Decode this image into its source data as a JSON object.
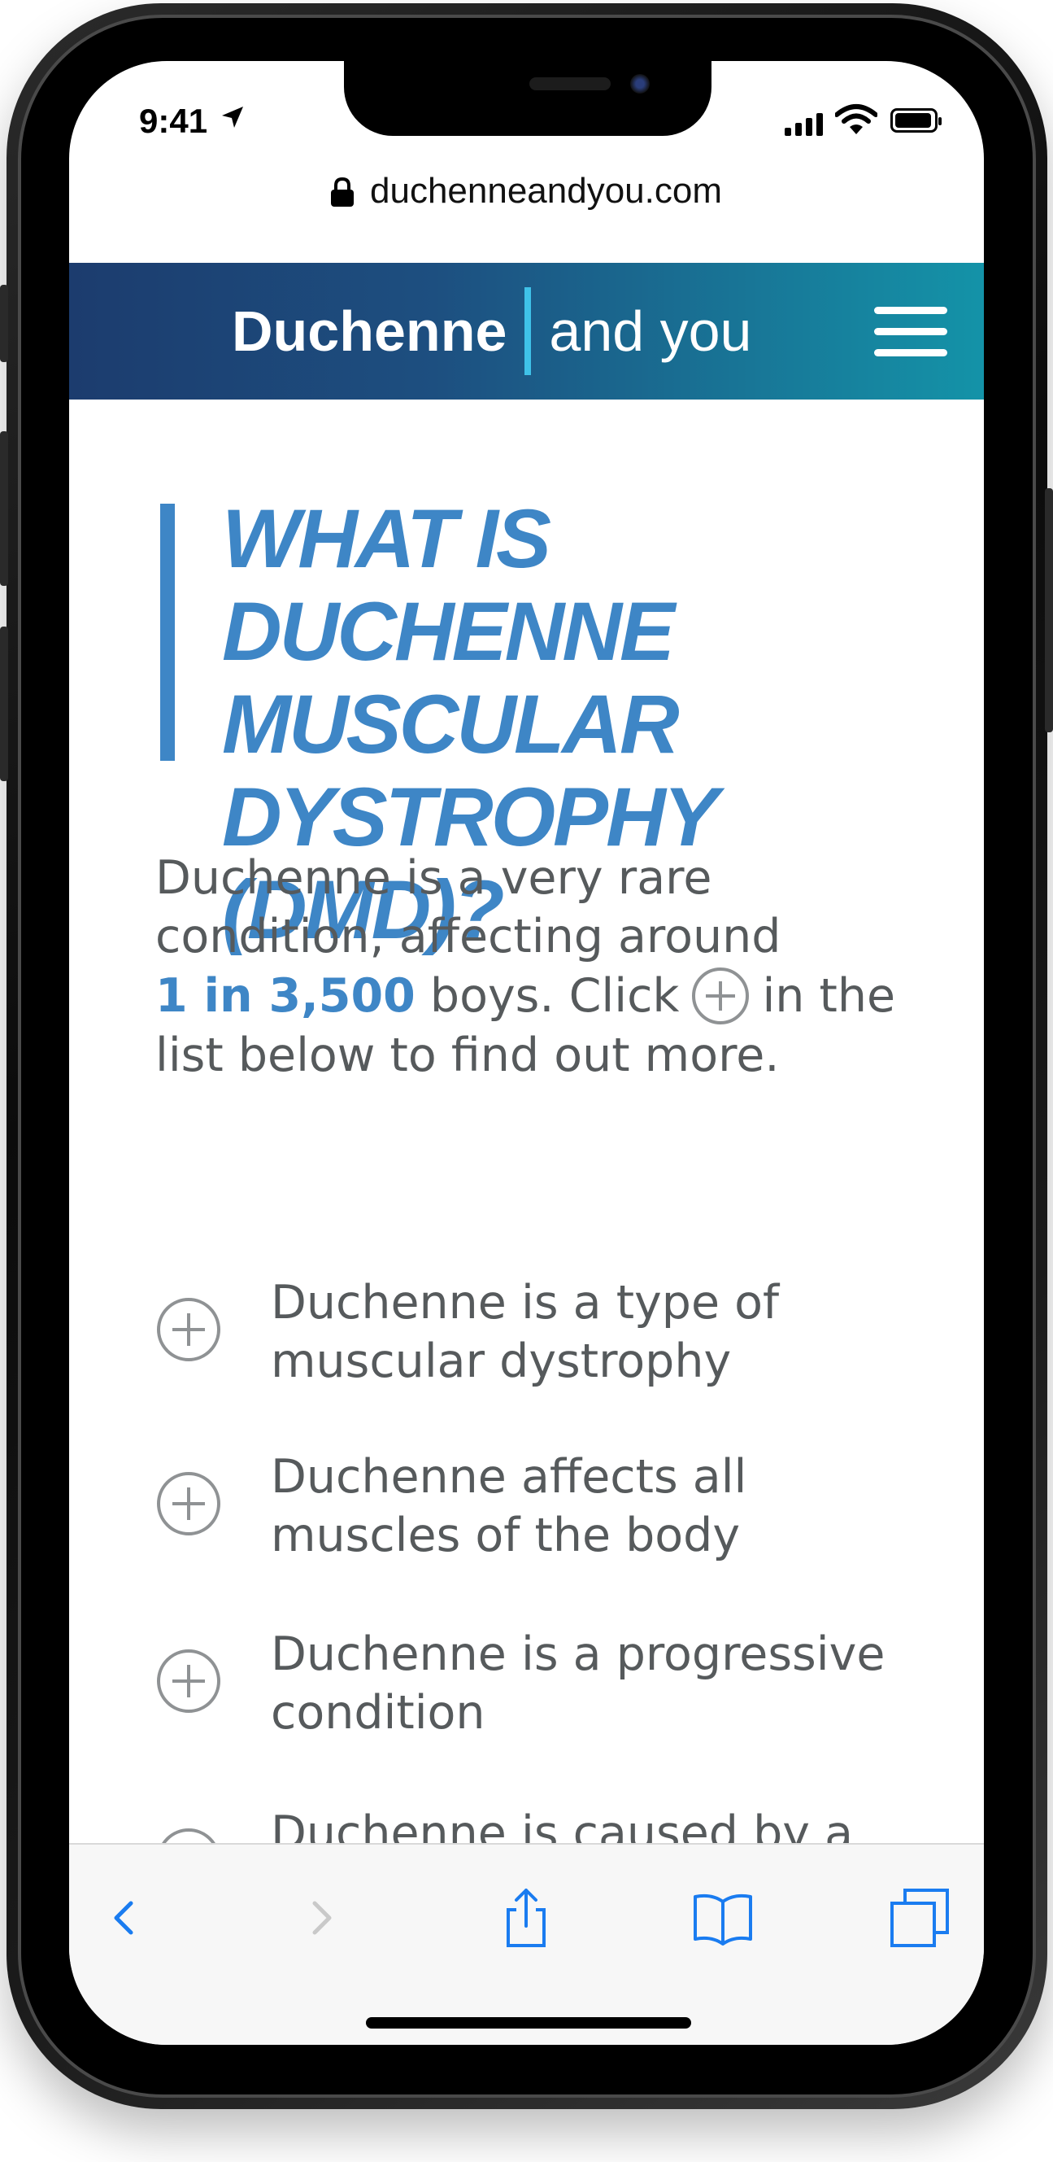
{
  "status_bar": {
    "time": "9:41"
  },
  "browser": {
    "url": "duchenneandyou.com"
  },
  "site": {
    "logo_bold": "Duchenne",
    "logo_light": "and you"
  },
  "article": {
    "title": "WHAT IS DUCHENNE MUSCULAR DYSTROPHY (DMD)?",
    "intro_part1": "Duchenne is a very rare condition, affecting around",
    "intro_highlight": "1 in 3,500",
    "intro_part2": "boys. Click",
    "intro_part3": "in the list below to find out more.",
    "items": [
      {
        "label": "Duchenne is a type of muscular dystrophy"
      },
      {
        "label": "Duchenne affects all muscles of the body"
      },
      {
        "label": "Duchenne is a progressive condition"
      },
      {
        "label": "Duchenne is caused by a lack of dystrophin protein"
      }
    ]
  },
  "icons": {
    "back": "chevron-left-icon",
    "forward": "chevron-right-icon",
    "share": "share-icon",
    "bookmarks": "book-icon",
    "tabs": "tabs-icon",
    "expand": "plus-circle-icon"
  },
  "colors": {
    "accent_blue": "#3e86c6",
    "header_start": "#1c3c6e",
    "header_end": "#1493a8",
    "text_gray": "#565a5c",
    "ios_blue": "#1a7cf0"
  }
}
